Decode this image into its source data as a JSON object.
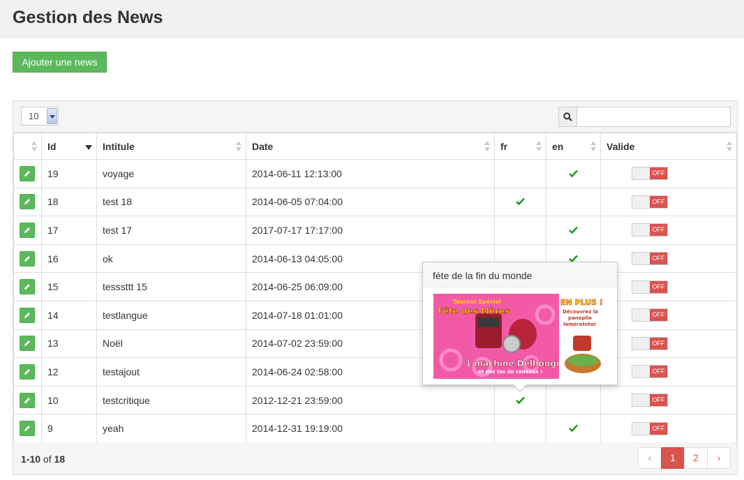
{
  "header": {
    "title": "Gestion des News"
  },
  "actions": {
    "add_label": "Ajouter une news"
  },
  "table": {
    "page_size": "10",
    "search_placeholder": "",
    "columns": {
      "id": "Id",
      "title": "Intitule",
      "date": "Date",
      "fr": "fr",
      "en": "en",
      "valid": "Valide"
    },
    "rows": [
      {
        "id": "19",
        "title": "voyage",
        "date": "2014-06-11 12:13:00",
        "fr": false,
        "en": true,
        "valid": "OFF"
      },
      {
        "id": "18",
        "title": "test 18",
        "date": "2014-06-05 07:04:00",
        "fr": true,
        "en": false,
        "valid": "OFF"
      },
      {
        "id": "17",
        "title": "test 17",
        "date": "2017-07-17 17:17:00",
        "fr": false,
        "en": true,
        "valid": "OFF"
      },
      {
        "id": "16",
        "title": "ok",
        "date": "2014-06-13 04:05:00",
        "fr": false,
        "en": true,
        "valid": "OFF"
      },
      {
        "id": "15",
        "title": "tesssttt 15",
        "date": "2014-06-25 06:09:00",
        "fr": false,
        "en": false,
        "valid": "OFF"
      },
      {
        "id": "14",
        "title": "testlangue",
        "date": "2014-07-18 01:01:00",
        "fr": false,
        "en": false,
        "valid": "OFF"
      },
      {
        "id": "13",
        "title": "Noël",
        "date": "2014-07-02 23:59:00",
        "fr": false,
        "en": false,
        "valid": "OFF"
      },
      {
        "id": "12",
        "title": "testajout",
        "date": "2014-06-24 02:58:00",
        "fr": false,
        "en": false,
        "valid": "OFF"
      },
      {
        "id": "10",
        "title": "testcritique",
        "date": "2012-12-21 23:59:00",
        "fr": true,
        "en": false,
        "valid": "OFF"
      },
      {
        "id": "9",
        "title": "yeah",
        "date": "2014-12-31 19:19:00",
        "fr": false,
        "en": true,
        "valid": "OFF"
      }
    ],
    "footer": {
      "range": "1-10",
      "of_label": "of",
      "total": "18"
    },
    "pagination": {
      "prev": "‹",
      "pages": [
        "1",
        "2"
      ],
      "next": "›",
      "active": "1"
    }
  },
  "popover": {
    "title": "féte de la fin du monde",
    "image": {
      "line1": "Tournoi Spécial",
      "line2": "Fête des Mères",
      "line3": "1 machine Delhongi",
      "line4": "et des tas de cadeaux !",
      "side1": "EN PLUS !",
      "side2": "Découvrez la",
      "side3": "panoplie",
      "side4": "lameratotor"
    }
  },
  "colors": {
    "success": "#5cb85c",
    "danger": "#d9534f",
    "check": "#1f9b1f"
  }
}
